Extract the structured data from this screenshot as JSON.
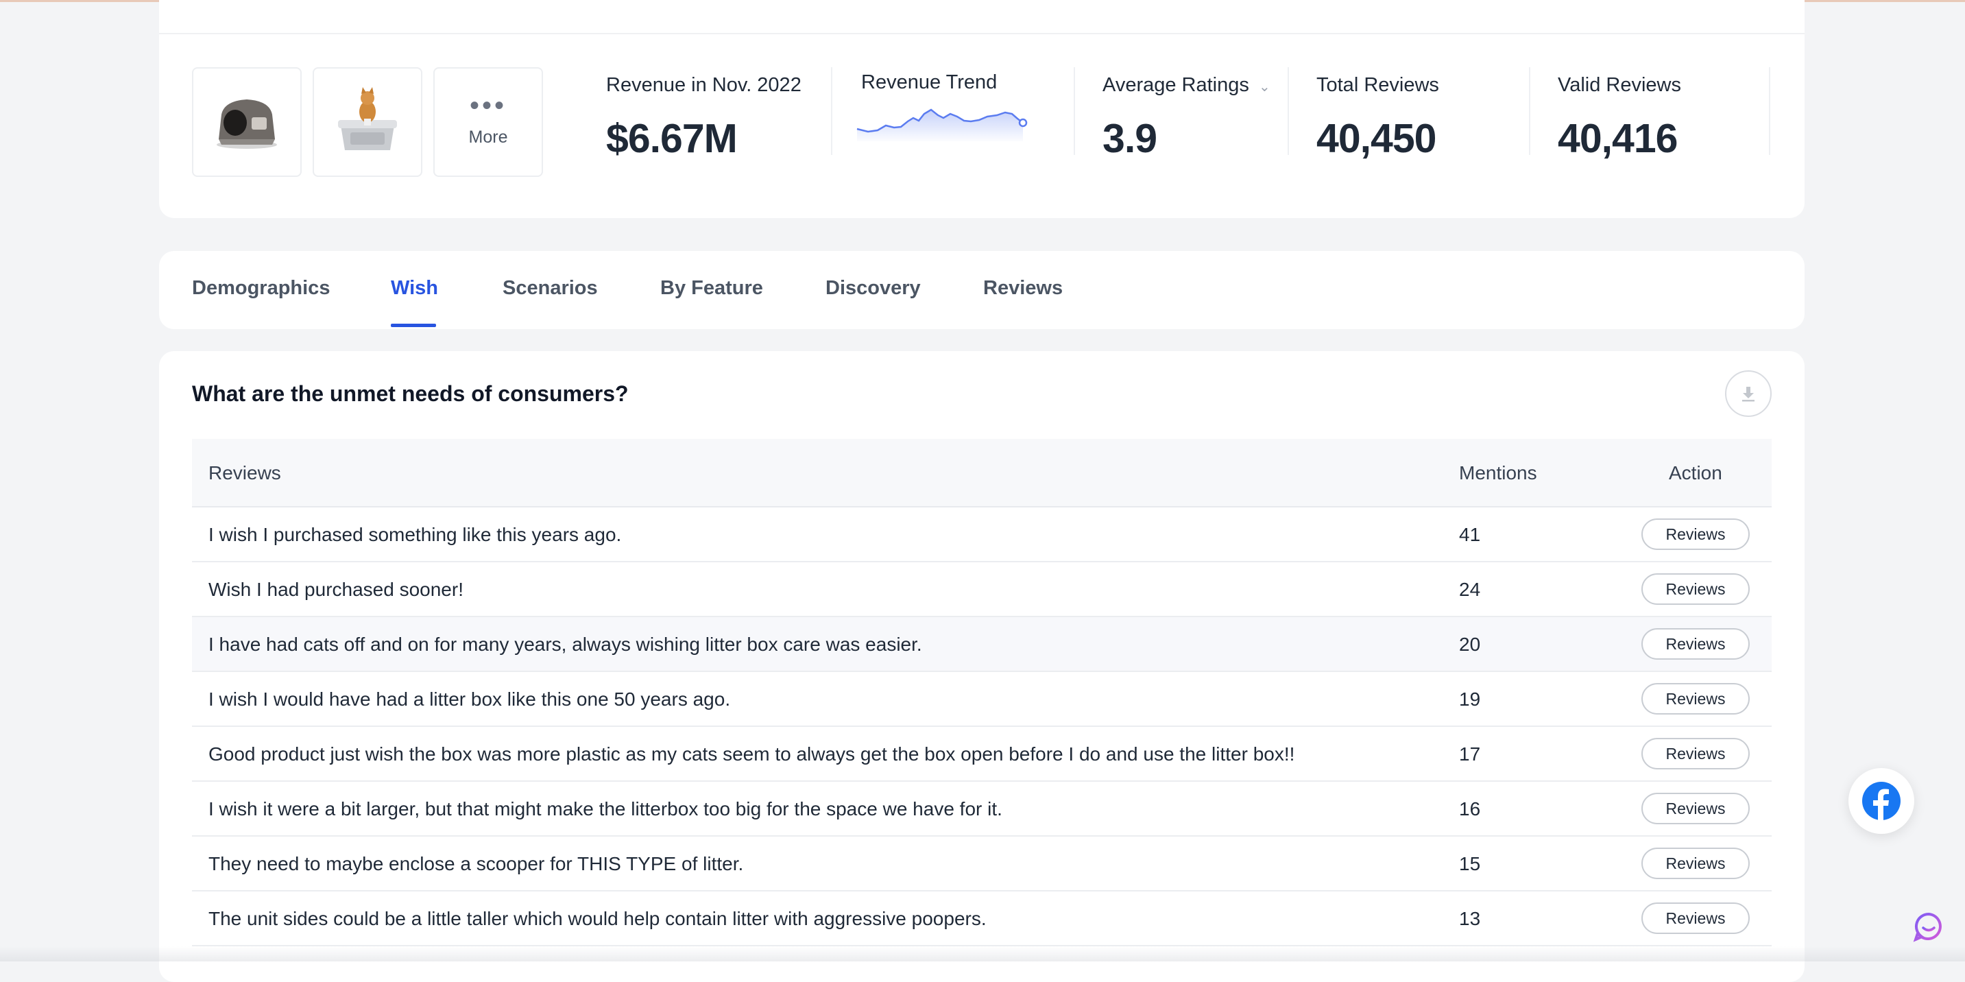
{
  "stats": {
    "more_dots": "•••",
    "more_label": "More",
    "revenue_label": "Revenue in Nov. 2022",
    "revenue_value": "$6.67M",
    "trend_label": "Revenue Trend",
    "ratings_label": "Average Ratings",
    "ratings_value": "3.9",
    "total_reviews_label": "Total Reviews",
    "total_reviews_value": "40,450",
    "valid_reviews_label": "Valid Reviews",
    "valid_reviews_value": "40,416",
    "trend_color": "#5b7cf0"
  },
  "tabs": {
    "items": [
      "Demographics",
      "Wish",
      "Scenarios",
      "By Feature",
      "Discovery",
      "Reviews"
    ],
    "active": "Wish"
  },
  "section": {
    "title": "What are the unmet needs of consumers?"
  },
  "table": {
    "headers": {
      "reviews": "Reviews",
      "mentions": "Mentions",
      "action": "Action"
    },
    "rows": [
      {
        "text": "I wish I purchased something like this years ago.",
        "mentions": "41",
        "action": "Reviews"
      },
      {
        "text": "Wish I had purchased sooner!",
        "mentions": "24",
        "action": "Reviews"
      },
      {
        "text": "I have had cats off and on for many years, always wishing litter box care was easier.",
        "mentions": "20",
        "action": "Reviews"
      },
      {
        "text": "I wish I would have had a litter box like this one 50 years ago.",
        "mentions": "19",
        "action": "Reviews"
      },
      {
        "text": "Good product just wish the box was more plastic as my cats seem to always get the box open before I do and use the litter box!!",
        "mentions": "17",
        "action": "Reviews"
      },
      {
        "text": "I wish it were a bit larger, but that might make the litterbox too big for the space we have for it.",
        "mentions": "16",
        "action": "Reviews"
      },
      {
        "text": "They need to maybe enclose a scooper for THIS TYPE of litter.",
        "mentions": "15",
        "action": "Reviews"
      },
      {
        "text": "The unit sides could be a little taller which would help contain litter with aggressive poopers.",
        "mentions": "13",
        "action": "Reviews"
      }
    ]
  },
  "colors": {
    "accent": "#2854e0",
    "facebook": "#1877f2"
  }
}
